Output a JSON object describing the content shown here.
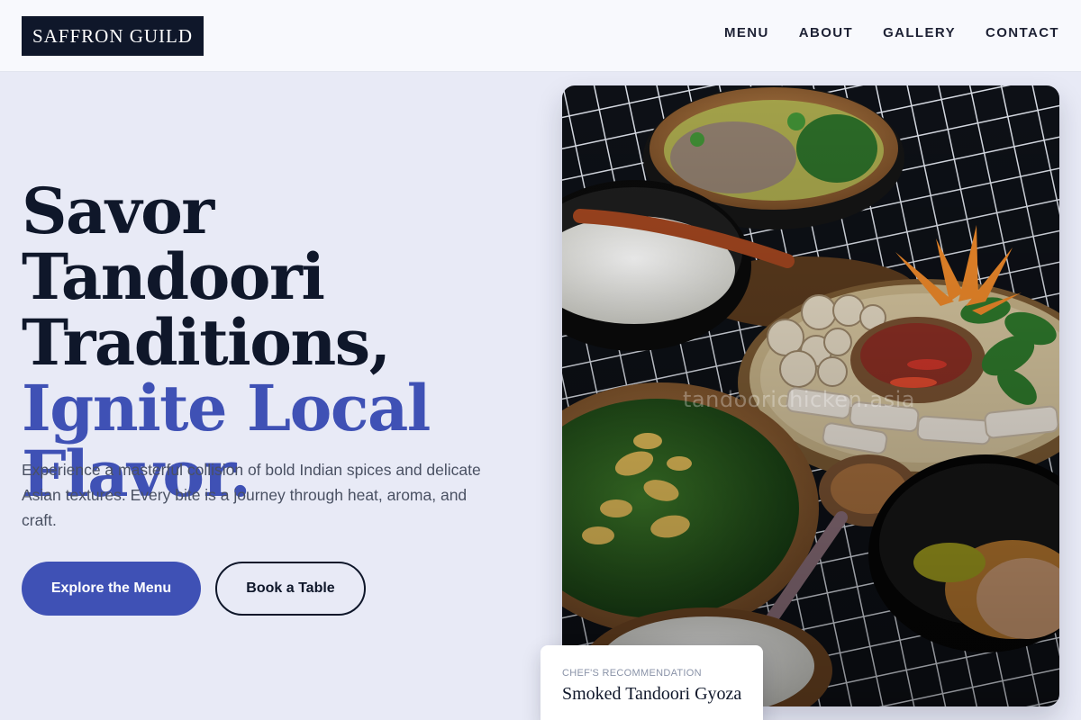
{
  "header": {
    "logo": "SAFFRON GUILD",
    "nav": [
      "MENU",
      "ABOUT",
      "GALLERY",
      "CONTACT"
    ]
  },
  "hero": {
    "headline_line1": "Savor Tandoori",
    "headline_line2": "Traditions,",
    "headline_line3": "Ignite Local",
    "headline_line4": "Flavor.",
    "lede": "Experience a masterful collision of bold Indian spices and delicate Asian textures. Every bite is a journey through heat, aroma, and craft.",
    "primary_button": "Explore the Menu",
    "secondary_button": "Book a Table"
  },
  "photo": {
    "watermark": "tandoorichicken.asia"
  },
  "recommendation": {
    "eyebrow": "Chef's Recommendation",
    "dish": "Smoked Tandoori Gyoza"
  },
  "colors": {
    "page_bg": "#e8eaf6",
    "header_bg": "#f8f9fd",
    "ink": "#0f172a",
    "accent": "#3f51b5",
    "muted": "#4a5163"
  }
}
